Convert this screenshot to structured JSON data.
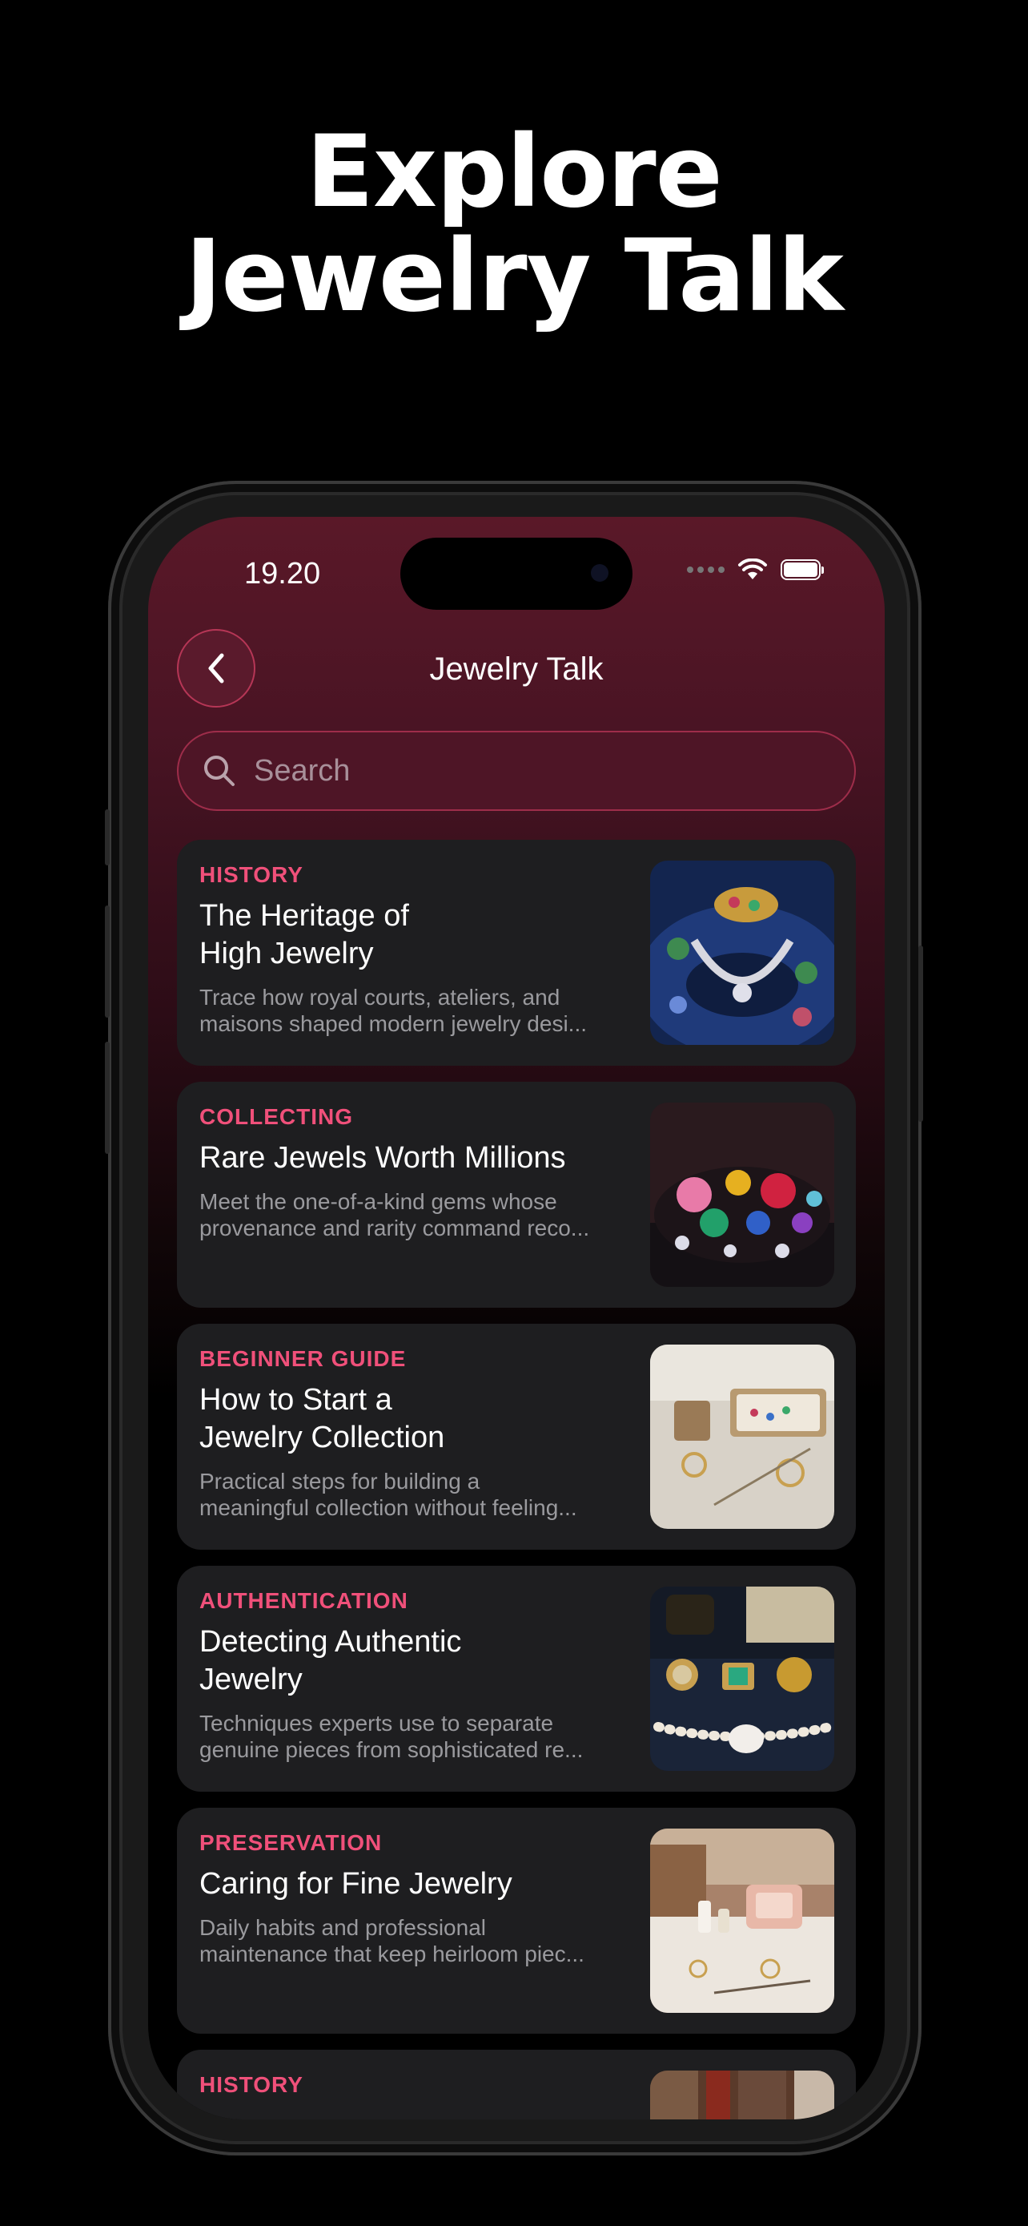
{
  "promo": {
    "headline_line1": "Explore",
    "headline_line2": "Jewelry Talk"
  },
  "status_bar": {
    "time": "19.20"
  },
  "nav": {
    "title": "Jewelry Talk"
  },
  "search": {
    "placeholder": "Search"
  },
  "articles": [
    {
      "category": "HISTORY",
      "title_line1": "The Heritage of",
      "title_line2": "High Jewelry",
      "desc_line1": "Trace how royal courts, ateliers, and",
      "desc_line2": "maisons shaped modern jewelry desi...",
      "image": "high-jewelry-collection"
    },
    {
      "category": "COLLECTING",
      "title_line1": "Rare Jewels Worth Millions",
      "title_line2": "",
      "desc_line1": "Meet the one-of-a-kind gems whose",
      "desc_line2": "provenance and rarity command reco...",
      "image": "rare-gemstones"
    },
    {
      "category": "BEGINNER GUIDE",
      "title_line1": "How to Start a",
      "title_line2": "Jewelry Collection",
      "desc_line1": "Practical steps for building a",
      "desc_line2": "meaningful collection without feeling...",
      "image": "jewelry-tray"
    },
    {
      "category": "AUTHENTICATION",
      "title_line1": "Detecting Authentic",
      "title_line2": "Jewelry",
      "desc_line1": "Techniques experts use to separate",
      "desc_line2": "genuine pieces from sophisticated re...",
      "image": "antique-pieces"
    },
    {
      "category": "PRESERVATION",
      "title_line1": "Caring for Fine Jewelry",
      "title_line2": "",
      "desc_line1": "Daily habits and professional",
      "desc_line2": "maintenance that keep heirloom piec...",
      "image": "jewelry-care-table"
    },
    {
      "category": "HISTORY",
      "title_line1": "",
      "title_line2": "",
      "desc_line1": "",
      "desc_line2": "",
      "image": "partial-card"
    }
  ],
  "colors": {
    "accent": "#f0507a",
    "card": "#1e1e20",
    "header_gradient": "#5a1828"
  }
}
